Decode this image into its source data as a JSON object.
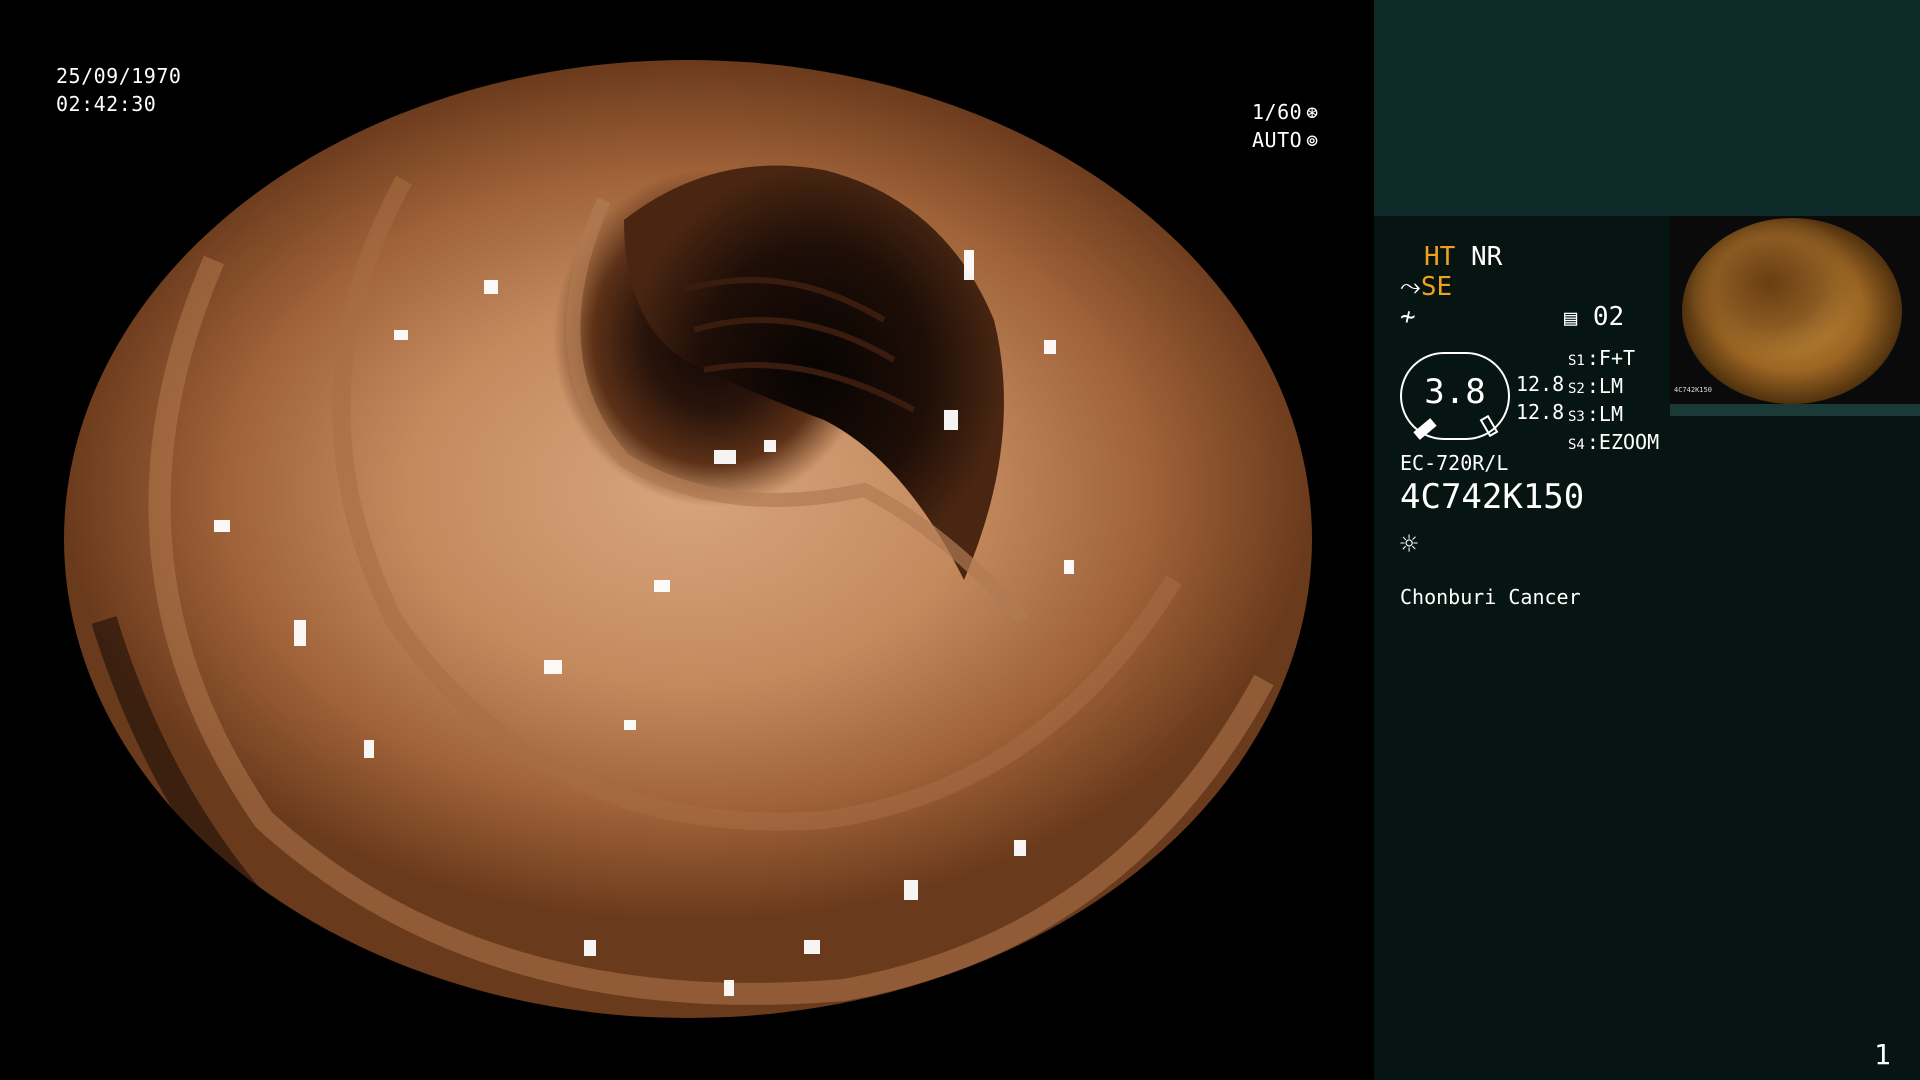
{
  "endoscope_view": {
    "date": "25/09/1970",
    "time": "02:42:30",
    "shutter_speed": "1/60",
    "exposure_mode": "AUTO",
    "shutter_icon": "aperture-icon",
    "auto_icon": "iris-icon"
  },
  "side_panel": {
    "mode_ht": "HT",
    "mode_nr": "NR",
    "mode_se": "SE",
    "se_icon": "scope-angle-icon",
    "scope_icon": "waveform-icon",
    "memory_icon": "memory-icon",
    "memory_count": "02",
    "gauge_value": "3.8",
    "num_top": "12.8",
    "num_bottom": "12.8",
    "switches": [
      {
        "key": "S1",
        "value": "F+T"
      },
      {
        "key": "S2",
        "value": "LM"
      },
      {
        "key": "S3",
        "value": "LM"
      },
      {
        "key": "S4",
        "value": "EZOOM"
      }
    ],
    "model": "EC-720R/L",
    "serial": "4C742K150",
    "light_icon": "sun-icon",
    "hospital": "Chonburi Cancer",
    "page_number": "1"
  },
  "colors": {
    "accent_orange": "#f0a020",
    "panel_bg": "#061412",
    "panel_top_bg": "#0e2a28"
  }
}
